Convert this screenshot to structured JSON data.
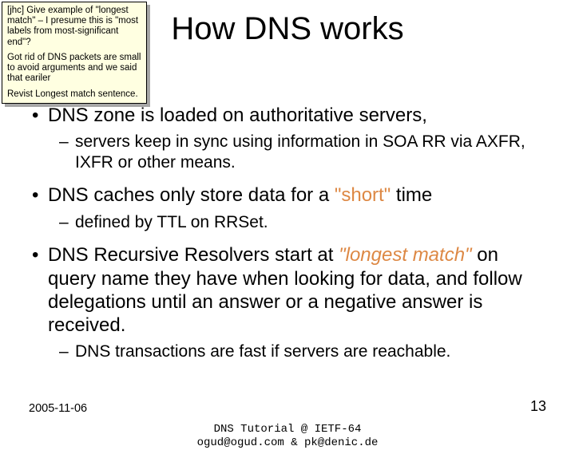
{
  "title": "How DNS works",
  "comment": {
    "p1": "[jhc] Give example of \"longest match\" – I presume this is \"most labels from most-significant end\"?",
    "p2": "Got rid of DNS packets are small to avoid arguments and we said that eariler",
    "p3": "Revist Longest match sentence."
  },
  "bullets": {
    "b1_pre": "DNS zone is loaded on authoritative servers,",
    "b1_sub": "servers keep in sync using information in SOA RR via AXFR, IXFR or other means.",
    "b2_pre": "DNS caches only store data for a ",
    "b2_hl": "\"short\"",
    "b2_post": " time",
    "b2_sub": "defined by TTL on RRSet.",
    "b3_pre": "DNS Recursive Resolvers start at ",
    "b3_hl": "\"longest match\"",
    "b3_post": " on query name they have when looking for data, and follow delegations until an answer or a negative answer is received.",
    "b3_sub": "DNS transactions are fast if servers are reachable."
  },
  "footer": {
    "date": "2005-11-06",
    "center1": "DNS Tutorial @ IETF-64",
    "center2": "ogud@ogud.com & pk@denic.de",
    "page": "13"
  }
}
